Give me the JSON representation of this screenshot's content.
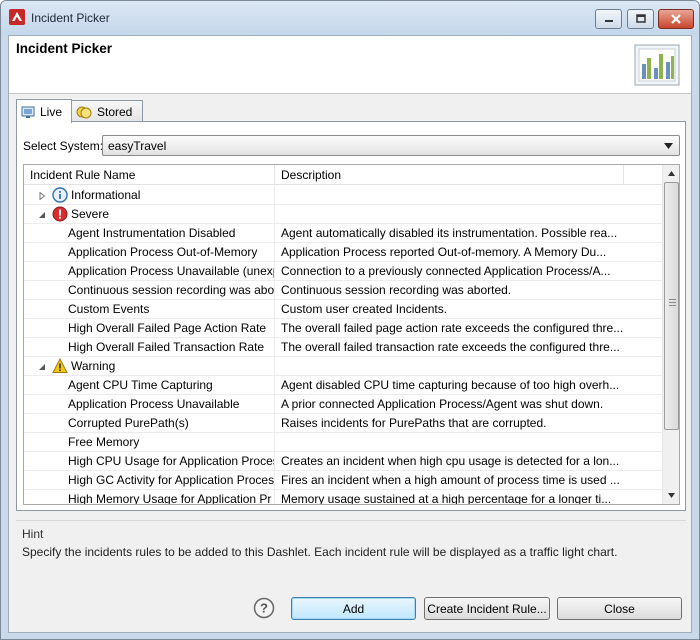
{
  "window": {
    "title": "Incident Picker",
    "colors": {
      "accent": "#c62828",
      "default_button": "#bee6fd"
    }
  },
  "banner": {
    "title": "Incident Picker",
    "image": "chart-report-icon"
  },
  "tabs": [
    {
      "label": "Live",
      "icon": "live-tab-icon",
      "active": true
    },
    {
      "label": "Stored",
      "icon": "stored-tab-icon",
      "active": false
    }
  ],
  "system": {
    "label": "Select System:",
    "value": "easyTravel"
  },
  "table": {
    "columns": [
      "Incident Rule Name",
      "Description"
    ],
    "rows": [
      {
        "type": "group",
        "name": "Informational",
        "icon": "info-icon",
        "expanded": false,
        "desc": ""
      },
      {
        "type": "group",
        "name": "Severe",
        "icon": "error-icon",
        "expanded": true,
        "desc": ""
      },
      {
        "type": "item",
        "name": "Agent Instrumentation Disabled",
        "desc": "Agent automatically disabled its instrumentation. Possible rea..."
      },
      {
        "type": "item",
        "name": "Application Process Out-of-Memory",
        "desc": "Application Process reported Out-of-memory. A Memory Du..."
      },
      {
        "type": "item",
        "name": "Application Process Unavailable (unexp",
        "desc": "Connection to a previously connected Application Process/A..."
      },
      {
        "type": "item",
        "name": "Continuous session recording was abor",
        "desc": "Continuous session recording was aborted."
      },
      {
        "type": "item",
        "name": "Custom Events",
        "desc": "Custom user created Incidents."
      },
      {
        "type": "item",
        "name": "High Overall Failed Page Action Rate",
        "desc": "The overall failed page action rate exceeds the configured thre..."
      },
      {
        "type": "item",
        "name": "High Overall Failed Transaction Rate",
        "desc": "The overall failed transaction rate exceeds the configured thre..."
      },
      {
        "type": "group",
        "name": "Warning",
        "icon": "warning-icon",
        "expanded": true,
        "desc": ""
      },
      {
        "type": "item",
        "name": "Agent CPU Time Capturing",
        "desc": "Agent disabled CPU time capturing because of too high overh..."
      },
      {
        "type": "item",
        "name": "Application Process Unavailable",
        "desc": "A prior connected Application Process/Agent was shut down."
      },
      {
        "type": "item",
        "name": "Corrupted PurePath(s)",
        "desc": "Raises incidents for PurePaths that are corrupted."
      },
      {
        "type": "item",
        "name": "Free Memory",
        "desc": ""
      },
      {
        "type": "item",
        "name": "High CPU Usage for Application Proces",
        "desc": "Creates an incident when high cpu usage is detected for a lon..."
      },
      {
        "type": "item",
        "name": "High GC Activity for Application Proces",
        "desc": "Fires an incident when a high amount of process time is used ..."
      },
      {
        "type": "item",
        "name": "High Memory Usage for Application Pr",
        "desc": "Memory usage sustained at a high percentage for a longer ti..."
      }
    ]
  },
  "hint": {
    "title": "Hint",
    "text": "Specify the incidents rules to be added to this Dashlet. Each incident rule will be displayed as a traffic light chart."
  },
  "buttons": {
    "add": "Add",
    "create": "Create Incident Rule...",
    "close": "Close"
  }
}
